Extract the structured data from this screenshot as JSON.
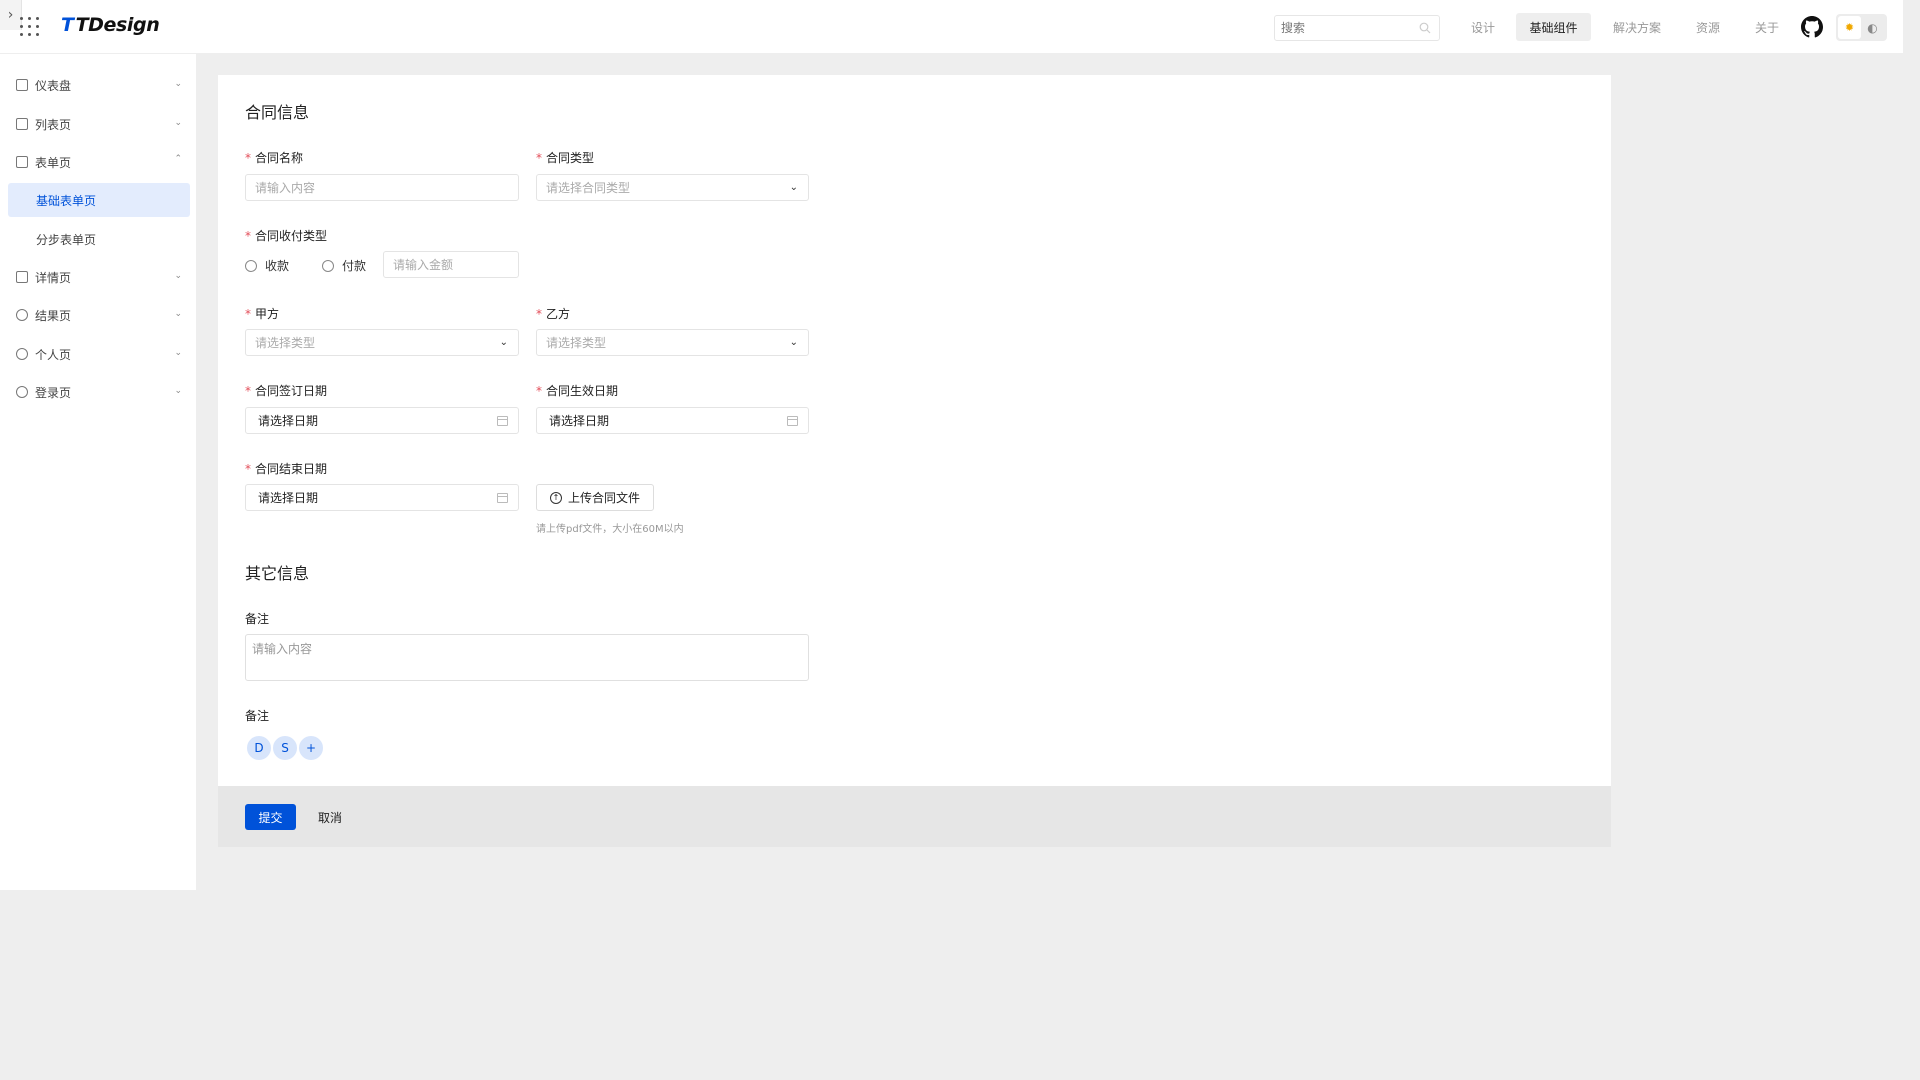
{
  "header": {
    "logo_text": "TDesign",
    "search_placeholder": "搜索",
    "nav": [
      "设计",
      "基础组件",
      "解决方案",
      "资源",
      "关于"
    ],
    "active_nav": "基础组件"
  },
  "sidebar": {
    "items": [
      {
        "label": "仪表盘",
        "icon": "dashboard-icon",
        "expanded": false
      },
      {
        "label": "列表页",
        "icon": "list-icon",
        "expanded": false
      },
      {
        "label": "表单页",
        "icon": "edit-icon",
        "expanded": true
      },
      {
        "label": "基础表单页",
        "sub": true,
        "active": true
      },
      {
        "label": "分步表单页",
        "sub": true,
        "active": false
      },
      {
        "label": "详情页",
        "icon": "detail-icon",
        "expanded": false
      },
      {
        "label": "结果页",
        "icon": "check-circle-icon",
        "expanded": false
      },
      {
        "label": "个人页",
        "icon": "user-circle-icon",
        "expanded": false
      },
      {
        "label": "登录页",
        "icon": "login-icon",
        "expanded": false
      }
    ]
  },
  "form": {
    "section1_title": "合同信息",
    "contract_name": {
      "label": "合同名称",
      "placeholder": "请输入内容"
    },
    "contract_type": {
      "label": "合同类型",
      "placeholder": "请选择合同类型"
    },
    "payment_type": {
      "label": "合同收付类型",
      "option_receive": "收款",
      "option_pay": "付款",
      "amount_placeholder": "请输入金额"
    },
    "party_a": {
      "label": "甲方",
      "placeholder": "请选择类型"
    },
    "party_b": {
      "label": "乙方",
      "placeholder": "请选择类型"
    },
    "sign_date": {
      "label": "合同签订日期",
      "value": "请选择日期"
    },
    "effective_date": {
      "label": "合同生效日期",
      "value": "请选择日期"
    },
    "end_date": {
      "label": "合同结束日期",
      "value": "请选择日期"
    },
    "upload": {
      "label": "上传合同文件",
      "hint": "请上传pdf文件，大小在60M以内"
    },
    "section2_title": "其它信息",
    "remark": {
      "label": "备注",
      "placeholder": "请输入内容"
    },
    "remark2_label": "备注",
    "avatars": [
      "D",
      "S",
      "+"
    ],
    "submit_label": "提交",
    "cancel_label": "取消"
  },
  "colors": {
    "primary": "#0052d9",
    "required": "#e34d59",
    "active_bg": "#e3ecfd"
  }
}
